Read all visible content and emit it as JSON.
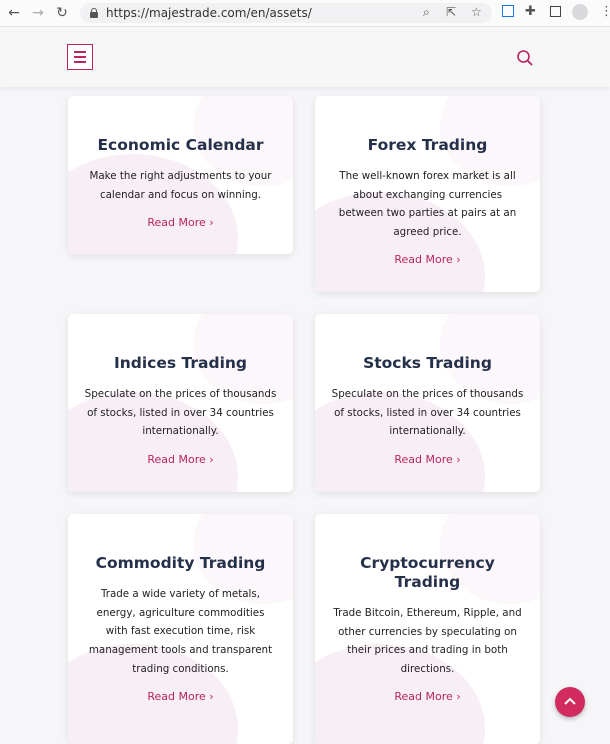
{
  "browser": {
    "url": "https://majestrade.com/en/assets/"
  },
  "cards": [
    {
      "title": "Economic Calendar",
      "desc": "Make the right adjustments to your calendar and focus on winning.",
      "link": "Read More"
    },
    {
      "title": "Forex Trading",
      "desc": "The well-known forex market is all about exchanging currencies between two parties at pairs at an agreed price.",
      "link": "Read More"
    },
    {
      "title": "Indices Trading",
      "desc": "Speculate on the prices of thousands of stocks, listed in over 34 countries internationally.",
      "link": "Read More"
    },
    {
      "title": "Stocks Trading",
      "desc": "Speculate on the prices of thousands of stocks, listed in over 34 countries internationally.",
      "link": "Read More"
    },
    {
      "title": "Commodity Trading",
      "desc": "Trade a wide variety of metals, energy, agriculture commodities with fast execution time, risk management tools and transparent trading conditions.",
      "link": "Read More"
    },
    {
      "title": "Cryptocurrency Trading",
      "desc": "Trade Bitcoin, Ethereum, Ripple, and other currencies by speculating on their prices and trading in both directions.",
      "link": "Read More"
    }
  ],
  "colors": {
    "accent": "#b8255f",
    "title": "#253049",
    "scroll_button": "#d12b5f"
  }
}
